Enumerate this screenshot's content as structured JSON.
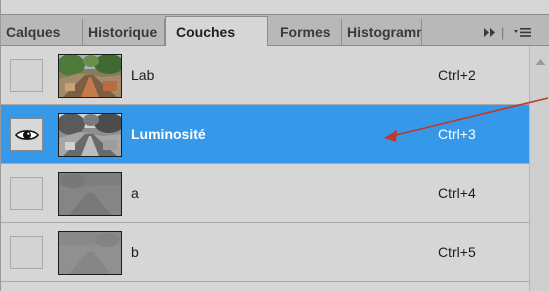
{
  "tabs": [
    {
      "label": "Calques",
      "active": false
    },
    {
      "label": "Historique",
      "active": false
    },
    {
      "label": "Couches",
      "active": true
    },
    {
      "label": "Formes",
      "active": false
    },
    {
      "label": "Histogramme",
      "active": false
    }
  ],
  "tab_controls": {
    "expand_icon": "double-chevron-right-icon",
    "menu_icon": "panel-menu-icon",
    "separator": "|"
  },
  "channels": [
    {
      "name": "Lab",
      "shortcut": "Ctrl+2",
      "visible": false,
      "selected": false,
      "thumbnail": "color"
    },
    {
      "name": "Luminosité",
      "shortcut": "Ctrl+3",
      "visible": true,
      "selected": true,
      "thumbnail": "grayscale"
    },
    {
      "name": "a",
      "shortcut": "Ctrl+4",
      "visible": false,
      "selected": false,
      "thumbnail": "flat-gray"
    },
    {
      "name": "b",
      "shortcut": "Ctrl+5",
      "visible": false,
      "selected": false,
      "thumbnail": "flat-gray"
    }
  ],
  "colors": {
    "panel_bg": "#d6d6d6",
    "tabbar_bg": "#b8b8b8",
    "selection": "#3598e8",
    "annotation_arrow": "#c0392b"
  }
}
